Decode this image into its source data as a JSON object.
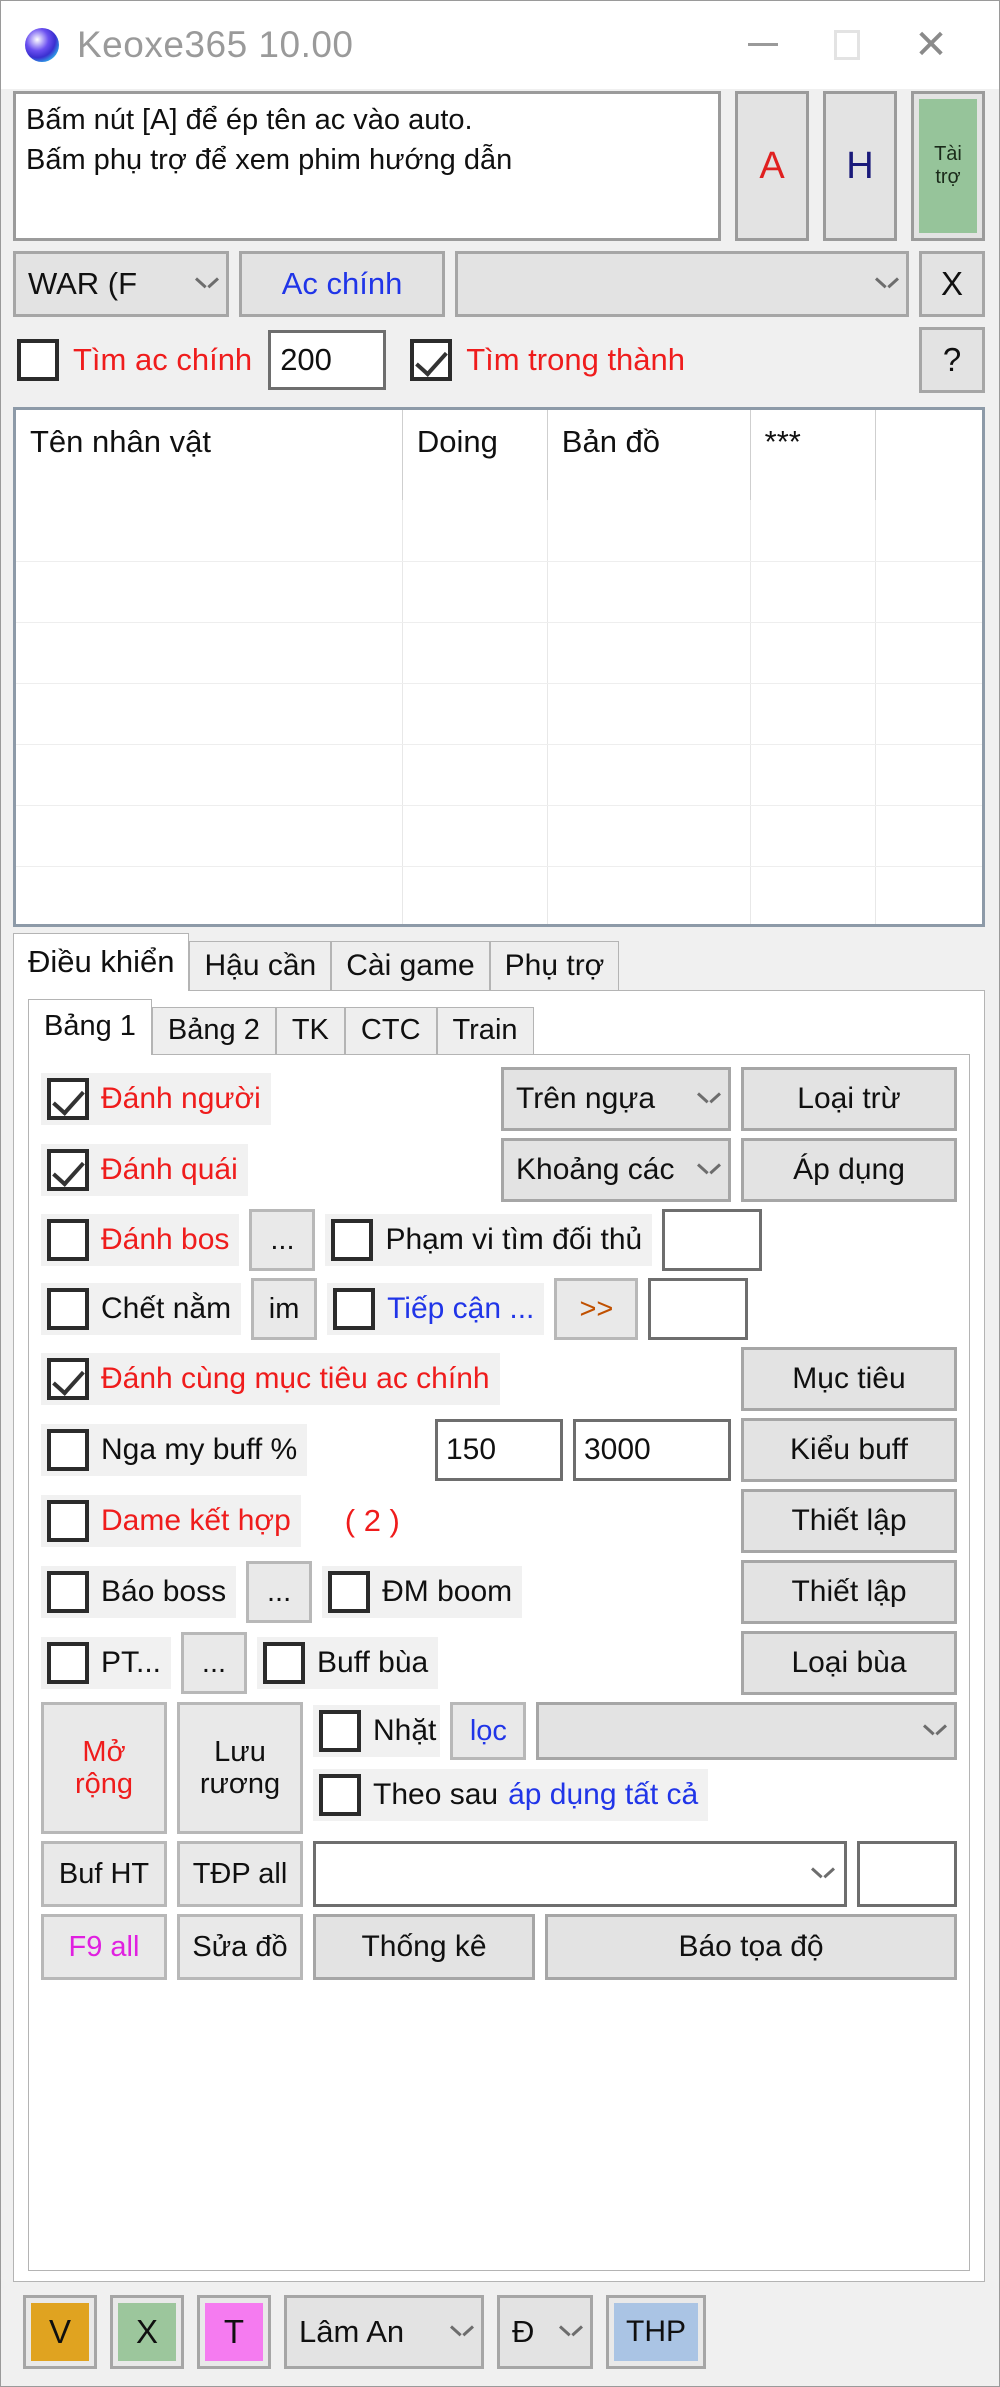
{
  "window": {
    "title": "Keoxe365 10.00",
    "icon": "app-orb-icon",
    "controls": {
      "minimize": "minimize-icon",
      "maximize": "maximize-icon",
      "close": "close-icon"
    }
  },
  "memo": {
    "line1": "Bấm nút [A] để ép tên ac vào auto.",
    "line2": "Bấm phụ trợ để xem phim hướng dẫn"
  },
  "side_buttons": {
    "a": "A",
    "h": "H",
    "donate_line1": "Tài",
    "donate_line2": "trợ",
    "donate_color": "#96c49a"
  },
  "combo_row": {
    "server": "WAR (F",
    "main_account_button": "Ac chính",
    "account_select": "",
    "close_button": "X"
  },
  "filter_row": {
    "find_main_label": "Tìm ac chính",
    "find_main_checked": false,
    "range_value": "200",
    "find_city_label": "Tìm trong thành",
    "find_city_checked": true,
    "help_button": "?"
  },
  "table": {
    "columns": [
      "Tên nhân vật",
      "Doing",
      "Bản đồ",
      "***",
      ""
    ],
    "rows": []
  },
  "tabs": [
    {
      "label": "Điều khiển",
      "active": true
    },
    {
      "label": "Hậu cần",
      "active": false
    },
    {
      "label": "Cài game",
      "active": false
    },
    {
      "label": "Phụ trợ",
      "active": false
    }
  ],
  "subtabs": [
    {
      "label": "Bảng 1",
      "active": true
    },
    {
      "label": "Bảng 2",
      "active": false
    },
    {
      "label": "TK",
      "active": false
    },
    {
      "label": "CTC",
      "active": false
    },
    {
      "label": "Train",
      "active": false
    }
  ],
  "controls": {
    "r1": {
      "check_label": "Đánh người",
      "checked": true,
      "combo": "Trên ngựa",
      "button": "Loại trừ"
    },
    "r2": {
      "check_label": "Đánh quái",
      "checked": true,
      "combo": "Khoảng các",
      "button": "Áp dụng"
    },
    "r3": {
      "check_label": "Đánh bos",
      "checked": false,
      "dots_button": "...",
      "check2_label": "Phạm vi tìm đối thủ",
      "check2_checked": false,
      "value": ""
    },
    "r4": {
      "check_label": "Chết nằm",
      "checked": false,
      "im_button": "im",
      "check2_label": "Tiếp cận ...",
      "check2_checked": false,
      "arrow_button": ">>",
      "value": ""
    },
    "r5": {
      "check_label": "Đánh cùng mục tiêu ac chính",
      "checked": true,
      "button": "Mục tiêu"
    },
    "r6": {
      "check_label": "Nga my buff %",
      "checked": false,
      "value1": "150",
      "value2": "3000",
      "button": "Kiểu buff"
    },
    "r7": {
      "check_label": "Dame kết hợp",
      "checked": false,
      "count": "( 2 )",
      "button": "Thiết lập"
    },
    "r8": {
      "check_label": "Báo boss",
      "checked": false,
      "dots_button": "...",
      "check2_label": "ĐM boom",
      "check2_checked": false,
      "button": "Thiết lập"
    },
    "r9": {
      "check_label": "PT...",
      "checked": false,
      "dots_button": "...",
      "check2_label": "Buff bùa",
      "check2_checked": false,
      "button": "Loại bùa"
    },
    "r10": {
      "expand_l1": "Mở",
      "expand_l2": "rộng",
      "save_l1": "Lưu",
      "save_l2": "rương",
      "pick_label": "Nhặt",
      "pick_checked": false,
      "filter_button": "lọc",
      "pick_combo": ""
    },
    "r11": {
      "follow_label": "Theo sau",
      "follow_link": "áp dụng tất cả",
      "follow_checked": false
    },
    "r12": {
      "buf_button": "Buf HT",
      "tdp_button": "TĐP all",
      "combo": "",
      "value": ""
    },
    "r13": {
      "f9_button": "F9 all",
      "fix_button": "Sửa đồ",
      "stats_button": "Thống kê",
      "coord_button": "Báo tọa độ"
    }
  },
  "bottom": {
    "v_label": "V",
    "v_color": "#e0a320",
    "x_label": "X",
    "x_color": "#9cc69c",
    "t_label": "T",
    "t_color": "#f57bf0",
    "map_select": "Lâm An",
    "dir_select": "Đ",
    "thp_label": "THP",
    "thp_color": "#aac4e4"
  },
  "colors": {
    "accent_red": "#ef1c1c",
    "accent_blue": "#2035e8",
    "accent_magenta": "#e020e0",
    "panel": "#f0f0f0",
    "button": "#e3e3e3"
  }
}
